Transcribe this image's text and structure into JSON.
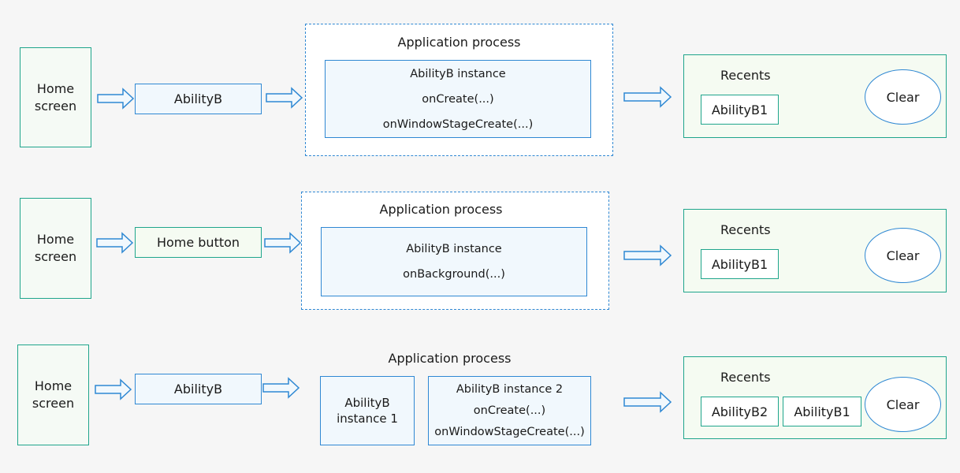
{
  "colors": {
    "background": "#f6f6f6",
    "teal_border": "#1fa58c",
    "blue_border": "#2f88d3",
    "blue_fill": "#f1f8fd",
    "green_fill": "#f5fbf2"
  },
  "rows": [
    {
      "home_screen": {
        "line1": "Home",
        "line2": "screen"
      },
      "trigger": {
        "label": "AbilityB",
        "style": "blue"
      },
      "process": {
        "title": "Application process",
        "instances": [
          {
            "lines": [
              "AbilityB instance",
              "onCreate(...)",
              "onWindowStageCreate(...)"
            ]
          }
        ]
      },
      "recents": {
        "title": "Recents",
        "cards": [
          "AbilityB1"
        ],
        "clear_label": "Clear"
      }
    },
    {
      "home_screen": {
        "line1": "Home",
        "line2": "screen"
      },
      "trigger": {
        "label": "Home button",
        "style": "green"
      },
      "process": {
        "title": "Application process",
        "instances": [
          {
            "lines": [
              "AbilityB instance",
              "onBackground(...)"
            ]
          }
        ]
      },
      "recents": {
        "title": "Recents",
        "cards": [
          "AbilityB1"
        ],
        "clear_label": "Clear"
      }
    },
    {
      "home_screen": {
        "line1": "Home",
        "line2": "screen"
      },
      "trigger": {
        "label": "AbilityB",
        "style": "blue"
      },
      "process": {
        "title": "Application process",
        "instances": [
          {
            "lines": [
              "AbilityB",
              "instance 1"
            ]
          },
          {
            "lines": [
              "AbilityB instance 2",
              "onCreate(...)",
              "onWindowStageCreate(...)"
            ]
          }
        ]
      },
      "recents": {
        "title": "Recents",
        "cards": [
          "AbilityB2",
          "AbilityB1"
        ],
        "clear_label": "Clear"
      }
    }
  ],
  "icons": {
    "flow_arrow": "right-arrow-icon"
  }
}
